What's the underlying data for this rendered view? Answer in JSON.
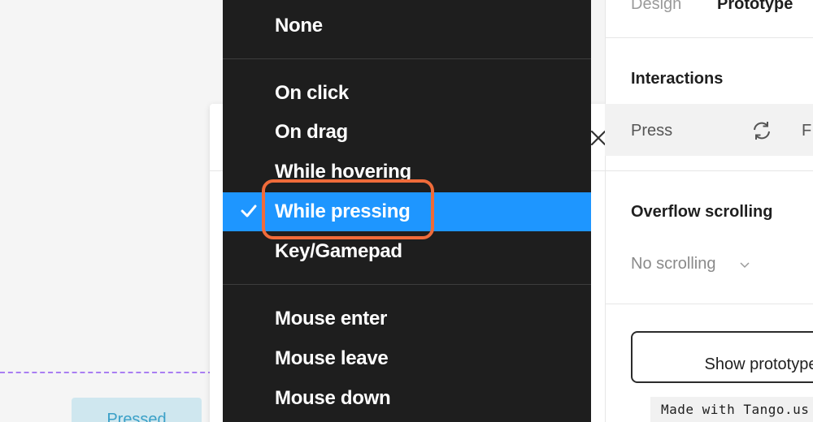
{
  "right_panel": {
    "tabs": [
      "Design",
      "Prototype"
    ],
    "interactions_title": "Interactions",
    "interaction_trigger": "Press",
    "interaction_trailing": "F",
    "overflow_title": "Overflow scrolling",
    "overflow_value": "No scrolling",
    "show_prototype_label": "Show prototype"
  },
  "canvas": {
    "pressed_chip": "Pressed"
  },
  "menu": {
    "items": [
      "None",
      "On click",
      "On drag",
      "While hovering",
      "While pressing",
      "Key/Gamepad",
      "Mouse enter",
      "Mouse leave",
      "Mouse down"
    ],
    "selected": "While pressing"
  },
  "watermark": "Made with Tango.us",
  "colors": {
    "menu_bg": "#1e1e1e",
    "selected_bg": "#1e96ff",
    "highlight": "#ef6b3a",
    "guide_dash": "#a97ef2"
  }
}
